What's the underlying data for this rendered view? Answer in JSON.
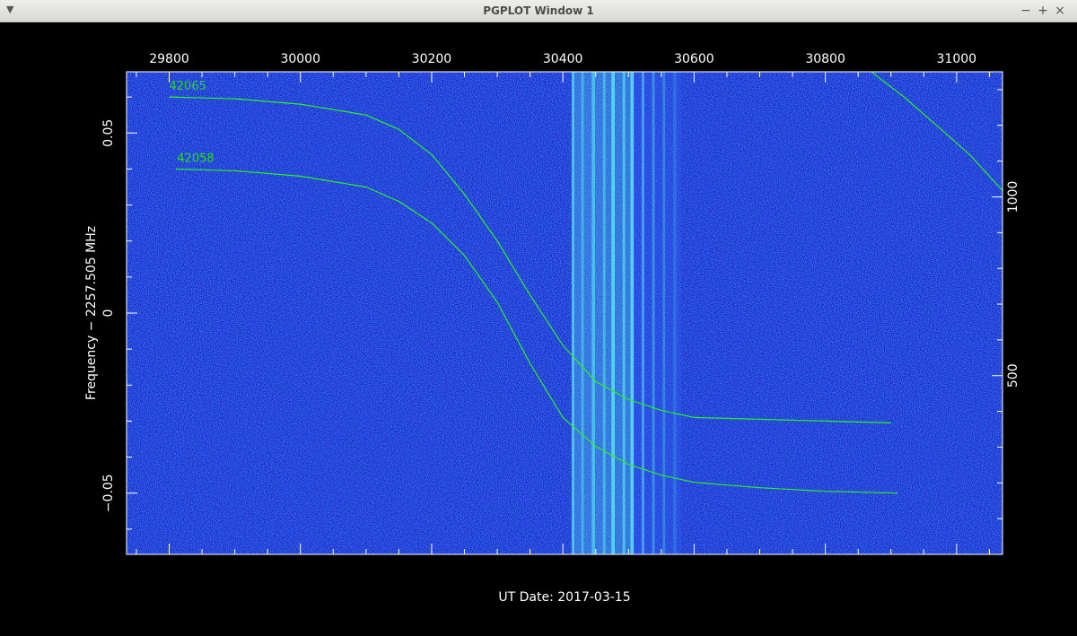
{
  "window": {
    "title": "PGPLOT Window 1",
    "menu_icon": "triangle-down-icon",
    "minimize_label": "−",
    "maximize_label": "+",
    "close_label": "×"
  },
  "colors": {
    "background": "#000000",
    "plot_fill": "#1a2cc8",
    "noise_dark": "#0d1a9e",
    "noise_light": "#2f62f0",
    "band_bright": "#55d8f0",
    "trace": "#28f028",
    "frame": "#ffffff",
    "text": "#ffffff",
    "label_green": "#26d926"
  },
  "chart_data": {
    "type": "heatmap",
    "xlabel": "UT Date: 2017-03-15",
    "ylabel": "Frequency − 2257.505 MHz",
    "xlim": [
      29735,
      31070
    ],
    "ylim": [
      -0.067,
      0.067
    ],
    "x_ticks": [
      29800,
      30000,
      30200,
      30400,
      30600,
      30800,
      31000
    ],
    "x_tick_labels": [
      "29800",
      "30000",
      "30200",
      "30400",
      "30600",
      "30800",
      "31000"
    ],
    "y_ticks": [
      -0.05,
      0,
      0.05
    ],
    "y_tick_labels": [
      "−0.05",
      "0",
      "0.05"
    ],
    "right_axis": {
      "range": [
        0,
        1350
      ],
      "ticks": [
        500,
        1000
      ],
      "tick_labels": [
        "500",
        "1000"
      ]
    },
    "bright_band": {
      "x_start": 30413,
      "x_end": 30505
    },
    "stripes": [
      {
        "x": 30414,
        "width": 3,
        "intensity": 0.95
      },
      {
        "x": 30428,
        "width": 4,
        "intensity": 0.55
      },
      {
        "x": 30444,
        "width": 5,
        "intensity": 0.7
      },
      {
        "x": 30461,
        "width": 4,
        "intensity": 0.6
      },
      {
        "x": 30474,
        "width": 5,
        "intensity": 0.95
      },
      {
        "x": 30491,
        "width": 4,
        "intensity": 0.75
      },
      {
        "x": 30503,
        "width": 5,
        "intensity": 0.95
      },
      {
        "x": 30520,
        "width": 4,
        "intensity": 0.6
      },
      {
        "x": 30536,
        "width": 4,
        "intensity": 0.45
      },
      {
        "x": 30552,
        "width": 4,
        "intensity": 0.35
      },
      {
        "x": 30568,
        "width": 5,
        "intensity": 0.2
      }
    ],
    "annotations": [
      {
        "text": "42065",
        "x": 29800,
        "y": 0.061
      },
      {
        "text": "42058",
        "x": 29812,
        "y": 0.041
      }
    ],
    "series": [
      {
        "name": "42065",
        "x": [
          29800,
          29900,
          30000,
          30100,
          30150,
          30200,
          30250,
          30300,
          30350,
          30400,
          30450,
          30500,
          30550,
          30600,
          30700,
          30800,
          30900
        ],
        "y": [
          0.06,
          0.0595,
          0.058,
          0.055,
          0.051,
          0.044,
          0.033,
          0.02,
          0.005,
          -0.009,
          -0.019,
          -0.024,
          -0.027,
          -0.029,
          -0.0295,
          -0.03,
          -0.0305
        ]
      },
      {
        "name": "42058",
        "x": [
          29810,
          29900,
          30000,
          30100,
          30150,
          30200,
          30250,
          30300,
          30350,
          30400,
          30450,
          30500,
          30550,
          30600,
          30700,
          30800,
          30910
        ],
        "y": [
          0.04,
          0.0395,
          0.038,
          0.035,
          0.031,
          0.025,
          0.016,
          0.003,
          -0.014,
          -0.029,
          -0.037,
          -0.042,
          -0.045,
          -0.047,
          -0.0485,
          -0.0495,
          -0.05
        ]
      },
      {
        "name": "",
        "x": [
          30870,
          30920,
          30970,
          31020,
          31070
        ],
        "y": [
          0.067,
          0.06,
          0.052,
          0.044,
          0.034
        ]
      }
    ]
  }
}
